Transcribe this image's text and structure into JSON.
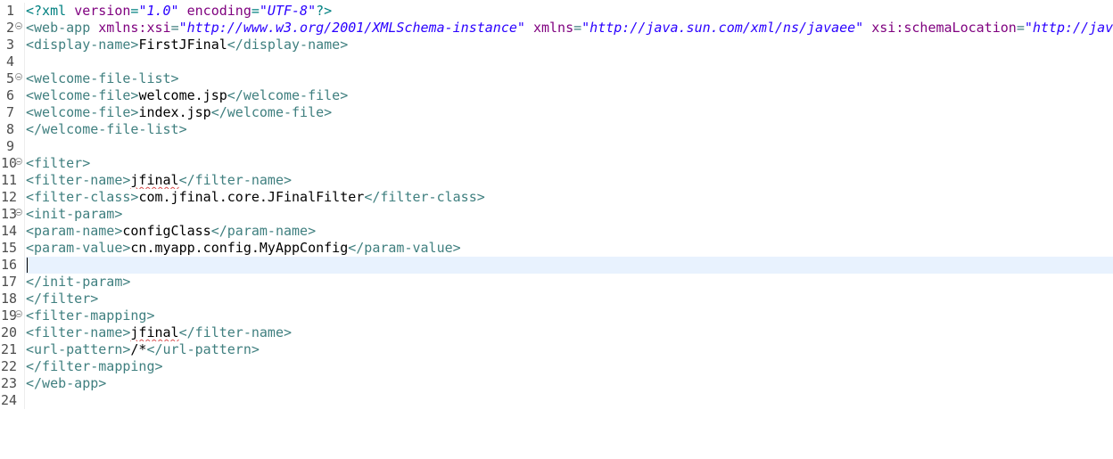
{
  "editor": {
    "language": "XML",
    "current_line": 16,
    "colors": {
      "background": "#ffffff",
      "current_line_highlight": "#e8f2fe",
      "tag": "#3f7f7f",
      "attribute_name": "#7f007f",
      "attribute_value": "#2a00ff",
      "processing_instruction": "#008080",
      "text": "#000000",
      "line_number": "#4d4d4d"
    },
    "lines": [
      {
        "num": "1",
        "fold": false,
        "tokens": [
          {
            "t": "pi",
            "v": "<?xml "
          },
          {
            "t": "an",
            "v": "version"
          },
          {
            "t": "pi",
            "v": "="
          },
          {
            "t": "av",
            "v": "\"1.0\""
          },
          {
            "t": "pi",
            "v": " "
          },
          {
            "t": "an",
            "v": "encoding"
          },
          {
            "t": "pi",
            "v": "="
          },
          {
            "t": "av",
            "v": "\"UTF-8\""
          },
          {
            "t": "pi",
            "v": "?>"
          }
        ]
      },
      {
        "num": "2",
        "fold": true,
        "tokens": [
          {
            "t": "tag",
            "v": "<web-app "
          },
          {
            "t": "an",
            "v": "xmlns:xsi"
          },
          {
            "t": "tag",
            "v": "="
          },
          {
            "t": "av",
            "v": "\"http://www.w3.org/2001/XMLSchema-instance\""
          },
          {
            "t": "tag",
            "v": " "
          },
          {
            "t": "an",
            "v": "xmlns"
          },
          {
            "t": "tag",
            "v": "="
          },
          {
            "t": "av",
            "v": "\"http://java.sun.com/xml/ns/javaee\""
          },
          {
            "t": "tag",
            "v": " "
          },
          {
            "t": "an",
            "v": "xsi:schemaLocation"
          },
          {
            "t": "tag",
            "v": "="
          },
          {
            "t": "av",
            "v": "\"http://jav"
          }
        ]
      },
      {
        "num": "3",
        "fold": false,
        "tokens": [
          {
            "t": "tag",
            "v": "<display-name>"
          },
          {
            "t": "txt",
            "v": "FirstJFinal"
          },
          {
            "t": "tag",
            "v": "</display-name>"
          }
        ]
      },
      {
        "num": "4",
        "fold": false,
        "tokens": []
      },
      {
        "num": "5",
        "fold": true,
        "tokens": [
          {
            "t": "tag",
            "v": "<welcome-file-list>"
          }
        ]
      },
      {
        "num": "6",
        "fold": false,
        "tokens": [
          {
            "t": "tag",
            "v": "<welcome-file>"
          },
          {
            "t": "txt",
            "v": "welcome.jsp"
          },
          {
            "t": "tag",
            "v": "</welcome-file>"
          }
        ]
      },
      {
        "num": "7",
        "fold": false,
        "tokens": [
          {
            "t": "tag",
            "v": "<welcome-file>"
          },
          {
            "t": "txt",
            "v": "index.jsp"
          },
          {
            "t": "tag",
            "v": "</welcome-file>"
          }
        ]
      },
      {
        "num": "8",
        "fold": false,
        "tokens": [
          {
            "t": "tag",
            "v": "</welcome-file-list>"
          }
        ]
      },
      {
        "num": "9",
        "fold": false,
        "tokens": []
      },
      {
        "num": "10",
        "fold": true,
        "tokens": [
          {
            "t": "tag",
            "v": "<filter>"
          }
        ]
      },
      {
        "num": "11",
        "fold": false,
        "tokens": [
          {
            "t": "tag",
            "v": "<filter-name>"
          },
          {
            "t": "txt",
            "v": "jfinal",
            "spell": true
          },
          {
            "t": "tag",
            "v": "</filter-name>"
          }
        ]
      },
      {
        "num": "12",
        "fold": false,
        "tokens": [
          {
            "t": "tag",
            "v": "<filter-class>"
          },
          {
            "t": "txt",
            "v": "com.jfinal.core.JFinalFilter"
          },
          {
            "t": "tag",
            "v": "</filter-class>"
          }
        ]
      },
      {
        "num": "13",
        "fold": true,
        "tokens": [
          {
            "t": "tag",
            "v": "<init-param>"
          }
        ]
      },
      {
        "num": "14",
        "fold": false,
        "tokens": [
          {
            "t": "tag",
            "v": "<param-name>"
          },
          {
            "t": "txt",
            "v": "configClass"
          },
          {
            "t": "tag",
            "v": "</param-name>"
          }
        ]
      },
      {
        "num": "15",
        "fold": false,
        "tokens": [
          {
            "t": "tag",
            "v": "<param-value>"
          },
          {
            "t": "txt",
            "v": "cn.myapp.config.MyAppConfig"
          },
          {
            "t": "tag",
            "v": "</param-value>"
          }
        ]
      },
      {
        "num": "16",
        "fold": false,
        "tokens": []
      },
      {
        "num": "17",
        "fold": false,
        "tokens": [
          {
            "t": "tag",
            "v": "</init-param>"
          }
        ]
      },
      {
        "num": "18",
        "fold": false,
        "tokens": [
          {
            "t": "tag",
            "v": "</filter>"
          }
        ]
      },
      {
        "num": "19",
        "fold": true,
        "tokens": [
          {
            "t": "tag",
            "v": "<filter-mapping>"
          }
        ]
      },
      {
        "num": "20",
        "fold": false,
        "tokens": [
          {
            "t": "tag",
            "v": "<filter-name>"
          },
          {
            "t": "txt",
            "v": "jfinal",
            "spell": true
          },
          {
            "t": "tag",
            "v": "</filter-name>"
          }
        ]
      },
      {
        "num": "21",
        "fold": false,
        "tokens": [
          {
            "t": "tag",
            "v": "<url-pattern>"
          },
          {
            "t": "txt",
            "v": "/*"
          },
          {
            "t": "tag",
            "v": "</url-pattern>"
          }
        ]
      },
      {
        "num": "22",
        "fold": false,
        "tokens": [
          {
            "t": "tag",
            "v": "</filter-mapping>"
          }
        ]
      },
      {
        "num": "23",
        "fold": false,
        "tokens": [
          {
            "t": "tag",
            "v": "</web-app>"
          }
        ]
      },
      {
        "num": "24",
        "fold": false,
        "tokens": []
      }
    ]
  }
}
